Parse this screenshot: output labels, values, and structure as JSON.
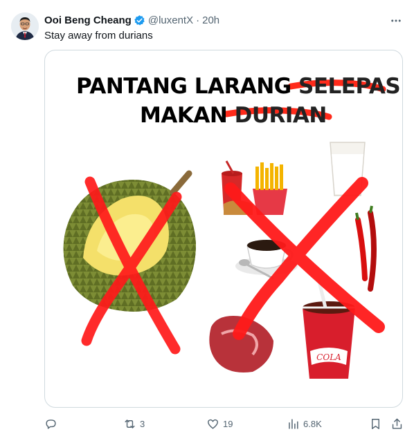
{
  "tweet": {
    "author_name": "Ooi Beng Cheang",
    "handle": "@luxentX",
    "separator": "·",
    "time": "20h",
    "text": "Stay away from durians",
    "more_icon": "more-horizontal-icon"
  },
  "poster": {
    "line1": "PANTANG LARANG",
    "line1_struck": "SELEPAS",
    "line2": "MAKAN",
    "line2_struck": "DURIAN",
    "strike_color": "#ff2a1a",
    "cross_color": "#ff1a1a"
  },
  "actions": {
    "reply_count": "",
    "retweet_count": "3",
    "like_count": "19",
    "views_count": "6.8K"
  },
  "colors": {
    "verified": "#1d9bf0",
    "secondary_text": "#536471",
    "border": "#cfd9de"
  }
}
